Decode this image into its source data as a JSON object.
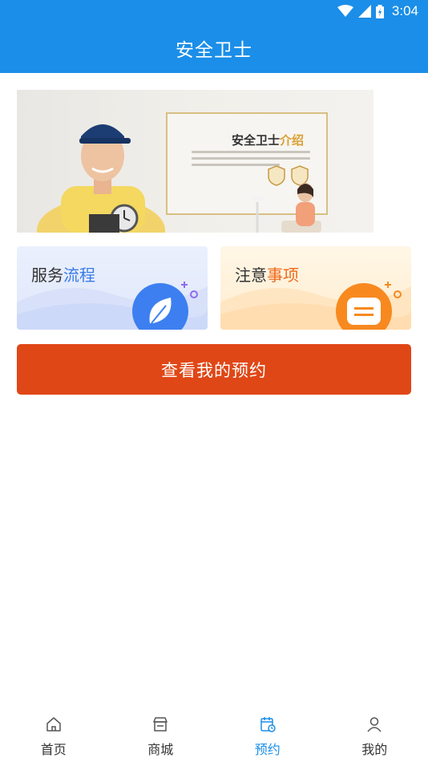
{
  "status_bar": {
    "time": "3:04",
    "icons": [
      "wifi-icon",
      "signal-icon",
      "battery-icon"
    ]
  },
  "header": {
    "title": "安全卫士"
  },
  "banner": {
    "title_main": "安全卫士",
    "title_accent": "介绍"
  },
  "cards": {
    "service": {
      "label_main": "服务",
      "label_accent": "流程",
      "icon": "leaf-icon"
    },
    "notes": {
      "label_main": "注意",
      "label_accent": "事项",
      "icon": "message-icon"
    }
  },
  "main_button": {
    "label": "查看我的预约"
  },
  "tabs": [
    {
      "label": "首页",
      "icon": "home-icon"
    },
    {
      "label": "商城",
      "icon": "store-icon"
    },
    {
      "label": "预约",
      "icon": "calendar-icon"
    },
    {
      "label": "我的",
      "icon": "user-icon"
    }
  ],
  "colors": {
    "primary": "#1a8ee8",
    "button": "#e04716",
    "service_accent": "#3a7be8",
    "notes_accent": "#f06a1a",
    "banner_gold": "#d9a033"
  }
}
